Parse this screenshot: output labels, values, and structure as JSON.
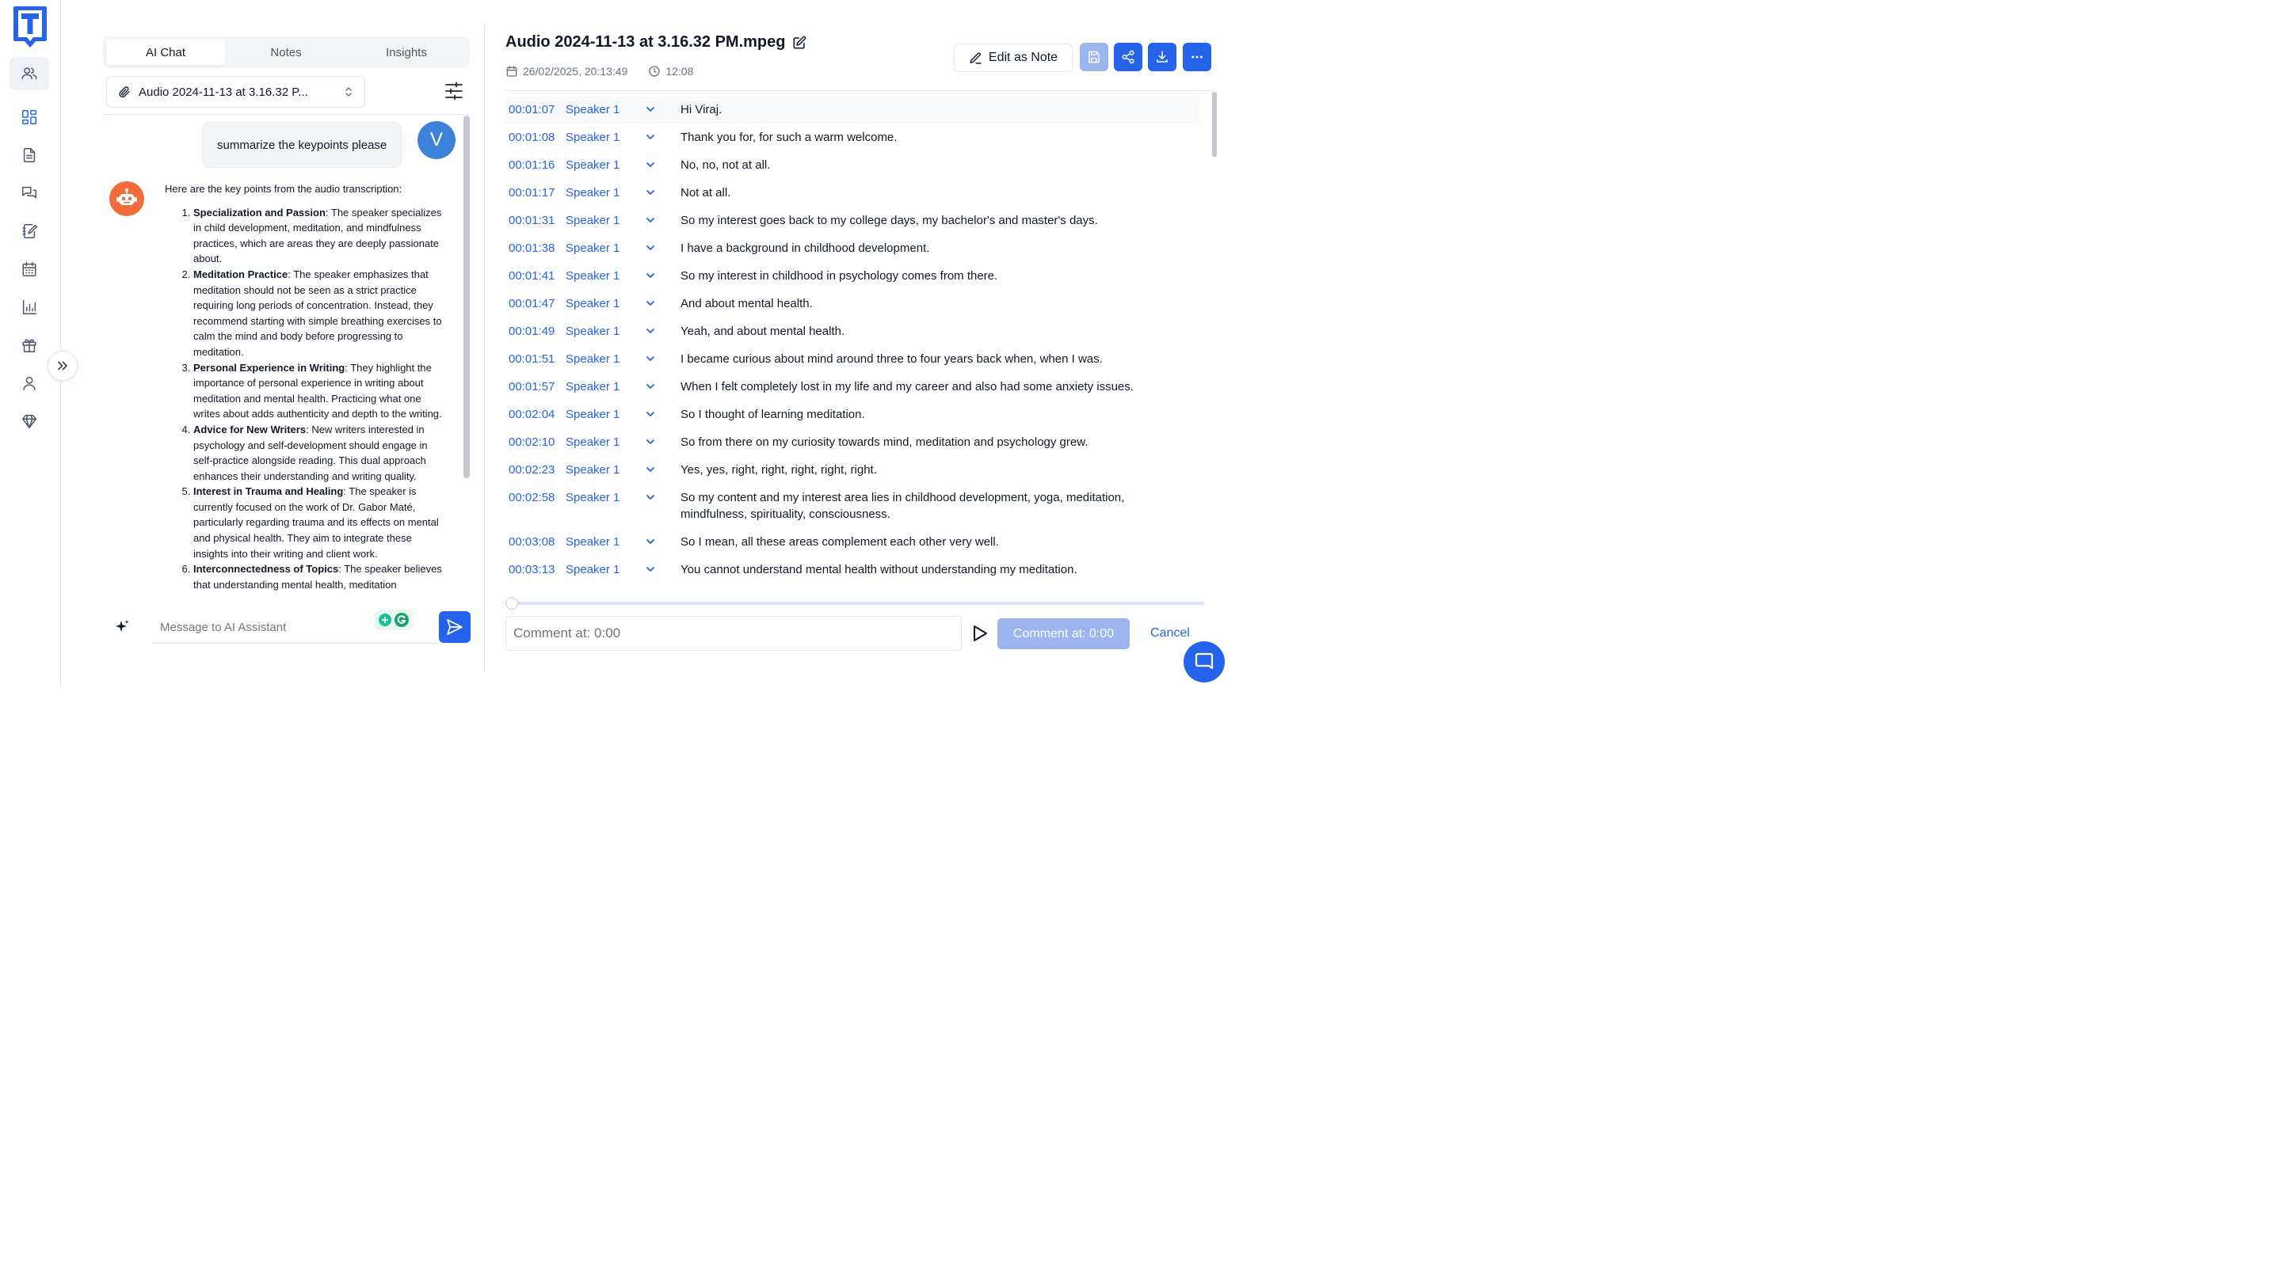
{
  "colors": {
    "accent": "#2563eb",
    "accent_disabled": "#9db5ee",
    "bot_avatar": "#f26b3a",
    "user_avatar": "#3b82d8"
  },
  "sidebar": {
    "logo_letter": "T",
    "items": [
      {
        "icon": "users-icon",
        "active": true
      },
      {
        "icon": "dashboard-grid-icon",
        "active": false
      },
      {
        "icon": "document-icon",
        "active": false
      },
      {
        "icon": "chat-bubbles-icon",
        "active": false
      },
      {
        "icon": "notebook-edit-icon",
        "active": false
      },
      {
        "icon": "calendar-icon",
        "active": false
      },
      {
        "icon": "bar-chart-icon",
        "active": false
      },
      {
        "icon": "gift-icon",
        "active": false
      },
      {
        "icon": "user-icon",
        "active": false
      },
      {
        "icon": "diamond-icon",
        "active": false
      }
    ],
    "collapse_icon": "double-chevron-right-icon"
  },
  "chat": {
    "tabs": [
      "AI Chat",
      "Notes",
      "Insights"
    ],
    "active_tab": "AI Chat",
    "file_select": "Audio 2024-11-13 at 3.16.32 P...",
    "user_message": "summarize the keypoints please",
    "user_initial": "V",
    "bot_intro": "Here are the key points from the audio transcription:",
    "bot_points": [
      {
        "title": "Specialization and Passion",
        "body": ": The speaker specializes in child development, meditation, and mindfulness practices, which are areas they are deeply passionate about."
      },
      {
        "title": "Meditation Practice",
        "body": ": The speaker emphasizes that meditation should not be seen as a strict practice requiring long periods of concentration. Instead, they recommend starting with simple breathing exercises to calm the mind and body before progressing to meditation."
      },
      {
        "title": "Personal Experience in Writing",
        "body": ": They highlight the importance of personal experience in writing about meditation and mental health. Practicing what one writes about adds authenticity and depth to the writing."
      },
      {
        "title": "Advice for New Writers",
        "body": ": New writers interested in psychology and self-development should engage in self-practice alongside reading. This dual approach enhances their understanding and writing quality."
      },
      {
        "title": "Interest in Trauma and Healing",
        "body": ": The speaker is currently focused on the work of Dr. Gabor Maté, particularly regarding trauma and its effects on mental and physical health. They aim to integrate these insights into their writing and client work."
      },
      {
        "title": "Interconnectedness of Topics",
        "body": ": The speaker believes that understanding mental health, meditation"
      }
    ],
    "input_placeholder": "Message to AI Assistant"
  },
  "transcript": {
    "title": "Audio 2024-11-13 at 3.16.32 PM.mpeg",
    "date": "26/02/2025, 20:13:49",
    "duration": "12:08",
    "edit_note_label": "Edit as Note",
    "rows": [
      {
        "time": "00:01:07",
        "speaker": "Speaker 1",
        "text": "Hi Viraj."
      },
      {
        "time": "00:01:08",
        "speaker": "Speaker 1",
        "text": "Thank you for, for such a warm welcome."
      },
      {
        "time": "00:01:16",
        "speaker": "Speaker 1",
        "text": "No, no, not at all."
      },
      {
        "time": "00:01:17",
        "speaker": "Speaker 1",
        "text": "Not at all."
      },
      {
        "time": "00:01:31",
        "speaker": "Speaker 1",
        "text": "So my interest goes back to my college days, my bachelor's and master's days."
      },
      {
        "time": "00:01:38",
        "speaker": "Speaker 1",
        "text": "I have a background in childhood development."
      },
      {
        "time": "00:01:41",
        "speaker": "Speaker 1",
        "text": "So my interest in childhood in psychology comes from there."
      },
      {
        "time": "00:01:47",
        "speaker": "Speaker 1",
        "text": "And about mental health."
      },
      {
        "time": "00:01:49",
        "speaker": "Speaker 1",
        "text": "Yeah, and about mental health."
      },
      {
        "time": "00:01:51",
        "speaker": "Speaker 1",
        "text": "I became curious about mind around three to four years back when, when I was."
      },
      {
        "time": "00:01:57",
        "speaker": "Speaker 1",
        "text": "When I felt completely lost in my life and my career and also had some anxiety issues."
      },
      {
        "time": "00:02:04",
        "speaker": "Speaker 1",
        "text": "So I thought of learning meditation."
      },
      {
        "time": "00:02:10",
        "speaker": "Speaker 1",
        "text": "So from there on my curiosity towards mind, meditation and psychology grew."
      },
      {
        "time": "00:02:23",
        "speaker": "Speaker 1",
        "text": "Yes, yes, right, right, right, right, right."
      },
      {
        "time": "00:02:58",
        "speaker": "Speaker 1",
        "text": "So my content and my interest area lies in childhood development, yoga, meditation, mindfulness, spirituality, consciousness."
      },
      {
        "time": "00:03:08",
        "speaker": "Speaker 1",
        "text": "So I mean, all these areas complement each other very well."
      },
      {
        "time": "00:03:13",
        "speaker": "Speaker 1",
        "text": "You cannot understand mental health without understanding my meditation."
      }
    ],
    "playback_progress": 0,
    "comment_placeholder": "Comment at: 0:00",
    "comment_button": "Comment at: 0:00",
    "cancel_label": "Cancel"
  }
}
